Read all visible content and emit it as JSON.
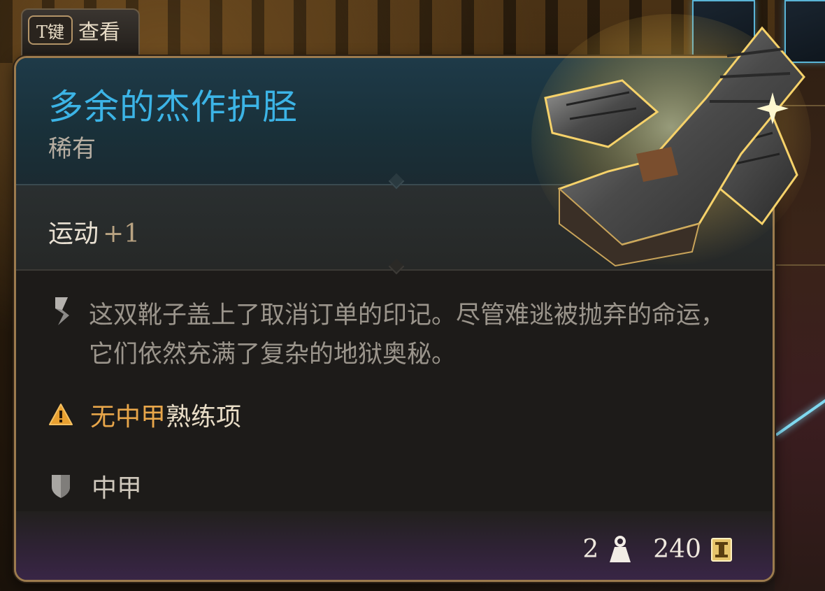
{
  "hint": {
    "key": "T键",
    "label": "查看"
  },
  "item": {
    "name": "多余的杰作护胫",
    "rarity": "稀有",
    "stat": {
      "name": "运动",
      "value": "+1"
    },
    "description": "这双靴子盖上了取消订单的印记。尽管难逃被抛弃的命运，它们依然充满了复杂的地狱奥秘。",
    "warning": {
      "highlight": "无中甲",
      "rest": "熟练项"
    },
    "armor_type": "中甲",
    "weight": "2",
    "value": "240"
  },
  "colors": {
    "name": "#3cb4e6",
    "rarity": "#b7aea2",
    "warning": "#e8a64a",
    "border": "#9c7b4e"
  },
  "icons": {
    "description": "scroll-icon",
    "warning": "warning-icon",
    "armor": "shield-icon",
    "weight": "weight-icon",
    "value": "gold-coin-icon"
  }
}
